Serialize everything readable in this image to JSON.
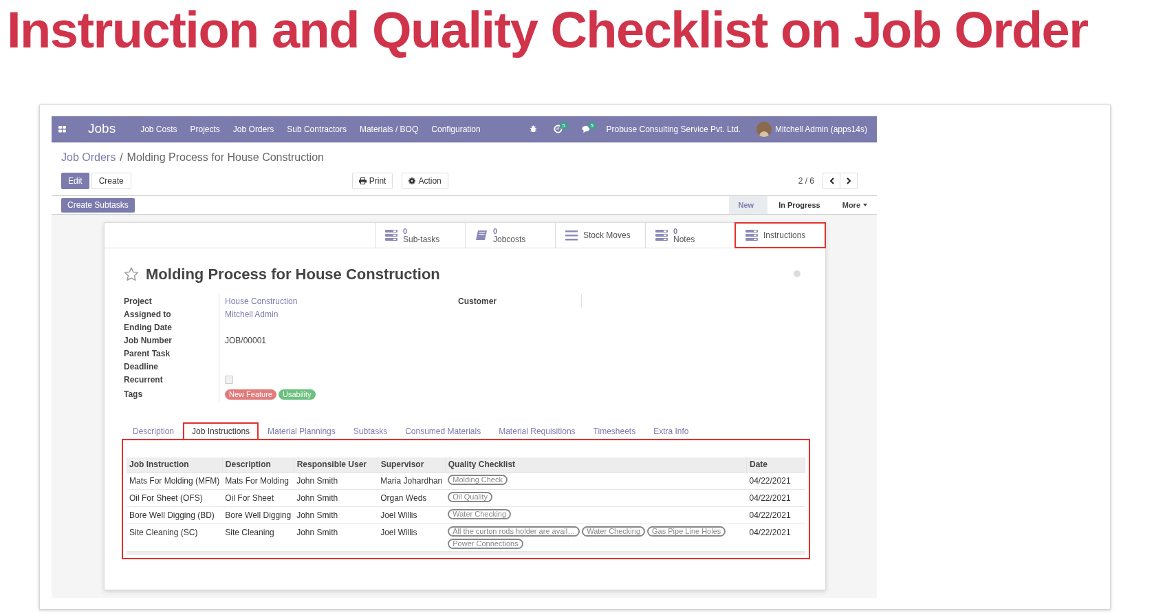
{
  "page_title": "Instruction and Quality Checklist on Job Order",
  "navbar": {
    "app_name": "Jobs",
    "menu": [
      "Job Costs",
      "Projects",
      "Job Orders",
      "Sub Contractors",
      "Materials / BOQ",
      "Configuration"
    ],
    "activity_count": "5",
    "message_count": "5",
    "company": "Probuse Consulting Service Pvt. Ltd.",
    "user": "Mitchell Admin (apps14s)"
  },
  "breadcrumb": {
    "parent": "Job Orders",
    "separator": "/",
    "current": "Molding Process for House Construction"
  },
  "buttons": {
    "edit": "Edit",
    "create": "Create",
    "print": "Print",
    "action": "Action"
  },
  "pager": "2 / 6",
  "header_button": "Create Subtasks",
  "stages": [
    {
      "label": "New",
      "selected": true
    },
    {
      "label": "In Progress",
      "selected": false
    }
  ],
  "more": "More",
  "stat_buttons": [
    {
      "kind": "count",
      "count": "0",
      "label": "Sub-tasks",
      "highlighted": false
    },
    {
      "kind": "count",
      "count": "0",
      "label": "Jobcosts",
      "highlighted": false
    },
    {
      "kind": "plain",
      "label": "Stock Moves",
      "highlighted": false
    },
    {
      "kind": "count",
      "count": "0",
      "label": "Notes",
      "highlighted": false
    },
    {
      "kind": "plain",
      "label": "Instructions",
      "highlighted": true
    }
  ],
  "record": {
    "starred": false,
    "title": "Molding Process for House Construction"
  },
  "fields": [
    {
      "kind": "link",
      "label": "Project",
      "value": "House Construction"
    },
    {
      "kind": "link",
      "label": "Assigned to",
      "value": "Mitchell Admin"
    },
    {
      "kind": "empty",
      "label": "Ending Date"
    },
    {
      "kind": "text",
      "label": "Job Number",
      "value": "JOB/00001"
    },
    {
      "kind": "empty",
      "label": "Parent Task"
    },
    {
      "kind": "empty",
      "label": "Deadline"
    },
    {
      "kind": "checkbox",
      "label": "Recurrent",
      "checked": false
    },
    {
      "kind": "tags",
      "label": "Tags",
      "tags": [
        {
          "label": "New Feature",
          "color": "#e27c7c"
        },
        {
          "label": "Usability",
          "color": "#6cc180"
        }
      ]
    }
  ],
  "right_fields": [
    {
      "label": "Customer"
    }
  ],
  "tabs": [
    {
      "label": "Description",
      "selected": false,
      "highlighted": false
    },
    {
      "label": "Job Instructions",
      "selected": true,
      "highlighted": true
    },
    {
      "label": "Material Plannings",
      "selected": false,
      "highlighted": false
    },
    {
      "label": "Subtasks",
      "selected": false,
      "highlighted": false
    },
    {
      "label": "Consumed Materials",
      "selected": false,
      "highlighted": false
    },
    {
      "label": "Material Requisitions",
      "selected": false,
      "highlighted": false
    },
    {
      "label": "Timesheets",
      "selected": false,
      "highlighted": false
    },
    {
      "label": "Extra Info",
      "selected": false,
      "highlighted": false
    }
  ],
  "table": {
    "highlighted": true,
    "columns": [
      "Job Instruction",
      "Description",
      "Responsible User",
      "Supervisor",
      "Quality Checklist",
      "Date"
    ],
    "rows": [
      {
        "job_instruction": "Mats For Molding (MFM)",
        "description": "Mats For Molding",
        "responsible_user": "John Smith",
        "supervisor": "Maria Johardhan",
        "quality_checklist": [
          "Molding Check"
        ],
        "date": "04/22/2021"
      },
      {
        "job_instruction": "Oil For Sheet (OFS)",
        "description": "Oil For Sheet",
        "responsible_user": "John Smith",
        "supervisor": "Organ Weds",
        "quality_checklist": [
          "Oil Quality"
        ],
        "date": "04/22/2021"
      },
      {
        "job_instruction": "Bore Well Digging (BD)",
        "description": "Bore Well Digging",
        "responsible_user": "John Smith",
        "supervisor": "Joel Willis",
        "quality_checklist": [
          "Water Checking"
        ],
        "date": "04/22/2021"
      },
      {
        "job_instruction": "Site Cleaning (SC)",
        "description": "Site Cleaning",
        "responsible_user": "John Smith",
        "supervisor": "Joel Willis",
        "quality_checklist": [
          "All the curton rods holder are avail…",
          "Water Checking",
          "Gas Pipe Line Holes",
          "Power Connections"
        ],
        "date": "04/22/2021"
      }
    ]
  }
}
